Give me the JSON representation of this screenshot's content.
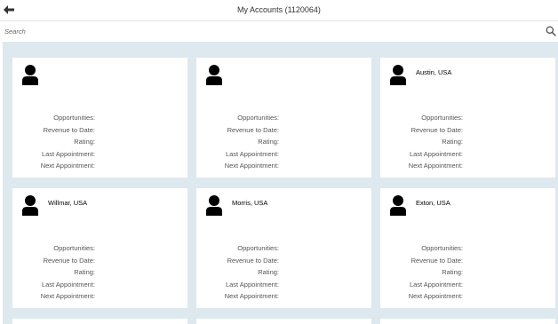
{
  "header": {
    "title": "My Accounts (1120064)",
    "back_icon": "arrow-left-icon"
  },
  "search": {
    "placeholder": "Search",
    "icon": "search-icon"
  },
  "fields": {
    "opportunities": "Opportunities:",
    "revenue": "Revenue to Date:",
    "rating": "Rating:",
    "last_appt": "Last Appointment:",
    "next_appt": "Next Appointment:"
  },
  "accounts": [
    {
      "name": ""
    },
    {
      "name": ""
    },
    {
      "name": "Austin, USA"
    },
    {
      "name": "Willmar, USA"
    },
    {
      "name": "Morris, USA"
    },
    {
      "name": "Exton, USA"
    }
  ],
  "colors": {
    "background": "#dde9ee",
    "card": "#ffffff",
    "avatar": "#000000"
  }
}
